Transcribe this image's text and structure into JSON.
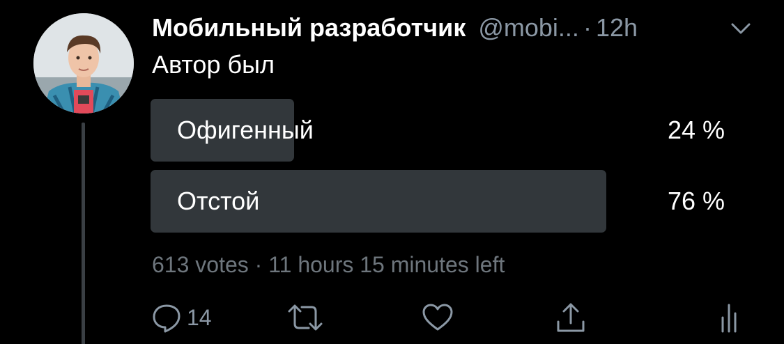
{
  "tweet": {
    "author_name": "Мобильный разработчик",
    "handle": "@mobi...",
    "separator": "·",
    "time": "12h",
    "text": "Автор был"
  },
  "poll": {
    "options": [
      {
        "label": "Офигенный",
        "percent_text": "24 %",
        "percent": 24
      },
      {
        "label": "Отстой",
        "percent_text": "76 %",
        "percent": 76
      }
    ],
    "meta": "613 votes · 11 hours 15 minutes left"
  },
  "actions": {
    "reply_count": "14",
    "icons": [
      "reply-icon",
      "retweet-icon",
      "like-icon",
      "share-icon",
      "analytics-icon"
    ]
  },
  "colors": {
    "background": "#000000",
    "poll_bar": "#32373b",
    "secondary_text": "#8b98a5"
  }
}
